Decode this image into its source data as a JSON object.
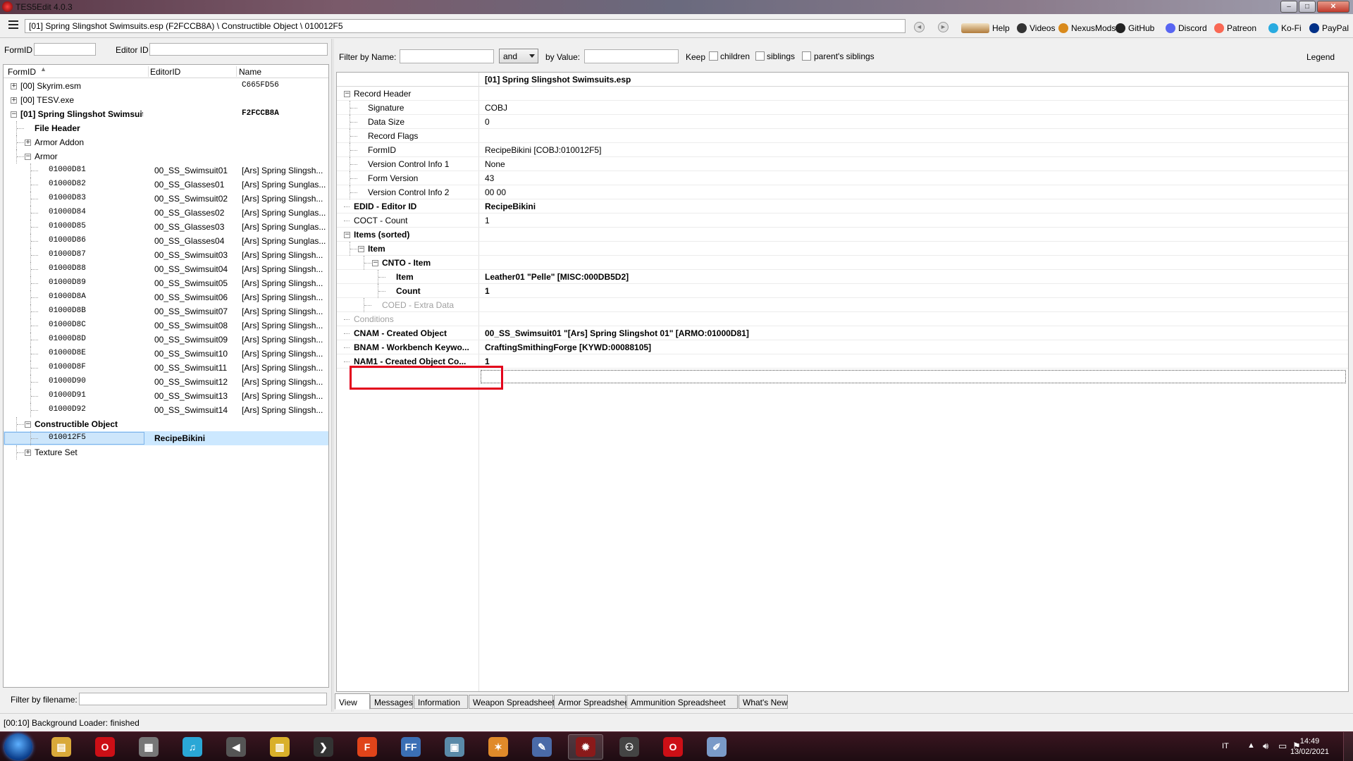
{
  "window": {
    "title": "TES5Edit 4.0.3",
    "min": "–",
    "max": "□",
    "close": "✕"
  },
  "toolbar": {
    "path": "[01] Spring Slingshot Swimsuits.esp (F2FCCB8A) \\ Constructible Object \\ 010012F5",
    "links": [
      {
        "label": "Help",
        "color": "#b07a3a"
      },
      {
        "label": "Videos",
        "color": "#333333"
      },
      {
        "label": "NexusMods",
        "color": "#d98a1c"
      },
      {
        "label": "GitHub",
        "color": "#222222"
      },
      {
        "label": "Discord",
        "color": "#5865f2"
      },
      {
        "label": "Patreon",
        "color": "#f96854"
      },
      {
        "label": "Ko-Fi",
        "color": "#29abe0"
      },
      {
        "label": "PayPal",
        "color": "#003087"
      }
    ]
  },
  "left": {
    "formid_label": "FormID",
    "editorid_label": "Editor ID",
    "columns": [
      "FormID",
      "EditorID",
      "Name"
    ],
    "filter_label": "Filter by filename:",
    "rows": [
      {
        "formid": "[00] Skyrim.esm",
        "editor": "",
        "name": "C665FD56",
        "level": 0,
        "exp": "+",
        "bold": false,
        "mono": false,
        "namemono": true
      },
      {
        "formid": "[00] TESV.exe",
        "editor": "",
        "name": "",
        "level": 0,
        "exp": "+",
        "bold": false,
        "mono": false
      },
      {
        "formid": "[01] Spring Slingshot Swimsuits.esp",
        "editor": "",
        "name": "F2FCCB8A",
        "level": 0,
        "exp": "−",
        "bold": true,
        "mono": false,
        "namemono": true
      },
      {
        "formid": "File Header",
        "editor": "",
        "name": "",
        "level": 1,
        "exp": "",
        "bold": true,
        "mono": false
      },
      {
        "formid": "Armor Addon",
        "editor": "",
        "name": "",
        "level": 1,
        "exp": "+",
        "bold": false,
        "mono": false
      },
      {
        "formid": "Armor",
        "editor": "",
        "name": "",
        "level": 1,
        "exp": "−",
        "bold": false,
        "mono": false
      },
      {
        "formid": "01000D81",
        "editor": "00_SS_Swimsuit01",
        "name": "[Ars] Spring Slingsh...",
        "level": 2,
        "exp": "",
        "bold": false,
        "mono": true
      },
      {
        "formid": "01000D82",
        "editor": "00_SS_Glasses01",
        "name": "[Ars] Spring Sunglas...",
        "level": 2,
        "exp": "",
        "bold": false,
        "mono": true
      },
      {
        "formid": "01000D83",
        "editor": "00_SS_Swimsuit02",
        "name": "[Ars] Spring Slingsh...",
        "level": 2,
        "exp": "",
        "bold": false,
        "mono": true
      },
      {
        "formid": "01000D84",
        "editor": "00_SS_Glasses02",
        "name": "[Ars] Spring Sunglas...",
        "level": 2,
        "exp": "",
        "bold": false,
        "mono": true
      },
      {
        "formid": "01000D85",
        "editor": "00_SS_Glasses03",
        "name": "[Ars] Spring Sunglas...",
        "level": 2,
        "exp": "",
        "bold": false,
        "mono": true
      },
      {
        "formid": "01000D86",
        "editor": "00_SS_Glasses04",
        "name": "[Ars] Spring Sunglas...",
        "level": 2,
        "exp": "",
        "bold": false,
        "mono": true
      },
      {
        "formid": "01000D87",
        "editor": "00_SS_Swimsuit03",
        "name": "[Ars] Spring Slingsh...",
        "level": 2,
        "exp": "",
        "bold": false,
        "mono": true
      },
      {
        "formid": "01000D88",
        "editor": "00_SS_Swimsuit04",
        "name": "[Ars] Spring Slingsh...",
        "level": 2,
        "exp": "",
        "bold": false,
        "mono": true
      },
      {
        "formid": "01000D89",
        "editor": "00_SS_Swimsuit05",
        "name": "[Ars] Spring Slingsh...",
        "level": 2,
        "exp": "",
        "bold": false,
        "mono": true
      },
      {
        "formid": "01000D8A",
        "editor": "00_SS_Swimsuit06",
        "name": "[Ars] Spring Slingsh...",
        "level": 2,
        "exp": "",
        "bold": false,
        "mono": true
      },
      {
        "formid": "01000D8B",
        "editor": "00_SS_Swimsuit07",
        "name": "[Ars] Spring Slingsh...",
        "level": 2,
        "exp": "",
        "bold": false,
        "mono": true
      },
      {
        "formid": "01000D8C",
        "editor": "00_SS_Swimsuit08",
        "name": "[Ars] Spring Slingsh...",
        "level": 2,
        "exp": "",
        "bold": false,
        "mono": true
      },
      {
        "formid": "01000D8D",
        "editor": "00_SS_Swimsuit09",
        "name": "[Ars] Spring Slingsh...",
        "level": 2,
        "exp": "",
        "bold": false,
        "mono": true
      },
      {
        "formid": "01000D8E",
        "editor": "00_SS_Swimsuit10",
        "name": "[Ars] Spring Slingsh...",
        "level": 2,
        "exp": "",
        "bold": false,
        "mono": true
      },
      {
        "formid": "01000D8F",
        "editor": "00_SS_Swimsuit11",
        "name": "[Ars] Spring Slingsh...",
        "level": 2,
        "exp": "",
        "bold": false,
        "mono": true
      },
      {
        "formid": "01000D90",
        "editor": "00_SS_Swimsuit12",
        "name": "[Ars] Spring Slingsh...",
        "level": 2,
        "exp": "",
        "bold": false,
        "mono": true
      },
      {
        "formid": "01000D91",
        "editor": "00_SS_Swimsuit13",
        "name": "[Ars] Spring Slingsh...",
        "level": 2,
        "exp": "",
        "bold": false,
        "mono": true
      },
      {
        "formid": "01000D92",
        "editor": "00_SS_Swimsuit14",
        "name": "[Ars] Spring Slingsh...",
        "level": 2,
        "exp": "",
        "bold": false,
        "mono": true
      },
      {
        "formid": "Constructible Object",
        "editor": "",
        "name": "",
        "level": 1,
        "exp": "−",
        "bold": true,
        "mono": false
      },
      {
        "formid": "010012F5",
        "editor": "RecipeBikini",
        "name": "",
        "level": 2,
        "exp": "",
        "bold": false,
        "mono": true,
        "selected": true,
        "editorbold": true
      },
      {
        "formid": "Texture Set",
        "editor": "",
        "name": "",
        "level": 1,
        "exp": "+",
        "bold": false,
        "mono": false
      }
    ]
  },
  "right": {
    "filter_name_label": "Filter by Name:",
    "and_value": "and",
    "by_value_label": "by Value:",
    "keep_label": "Keep",
    "children_label": "children",
    "siblings_label": "siblings",
    "parents_siblings_label": "parent's siblings",
    "legend_label": "Legend",
    "header": "[01] Spring Slingshot Swimsuits.esp",
    "rows": [
      {
        "name": "Record Header",
        "value": "",
        "level": 0,
        "exp": "−",
        "bold": false,
        "gray": false
      },
      {
        "name": "Signature",
        "value": "COBJ",
        "level": 1,
        "exp": "",
        "bold": false,
        "gray": false
      },
      {
        "name": "Data Size",
        "value": "0",
        "level": 1,
        "exp": "",
        "bold": false,
        "gray": false
      },
      {
        "name": "Record Flags",
        "value": "",
        "level": 1,
        "exp": "",
        "bold": false,
        "gray": false
      },
      {
        "name": "FormID",
        "value": "RecipeBikini [COBJ:010012F5]",
        "level": 1,
        "exp": "",
        "bold": false,
        "gray": false
      },
      {
        "name": "Version Control Info 1",
        "value": "None",
        "level": 1,
        "exp": "",
        "bold": false,
        "gray": false
      },
      {
        "name": "Form Version",
        "value": "43",
        "level": 1,
        "exp": "",
        "bold": false,
        "gray": false
      },
      {
        "name": "Version Control Info 2",
        "value": "00 00",
        "level": 1,
        "exp": "",
        "bold": false,
        "gray": false
      },
      {
        "name": "EDID - Editor ID",
        "value": "RecipeBikini",
        "level": 0,
        "exp": "",
        "bold": true,
        "gray": false
      },
      {
        "name": "COCT - Count",
        "value": "1",
        "level": 0,
        "exp": "",
        "bold": false,
        "gray": false
      },
      {
        "name": "Items (sorted)",
        "value": "",
        "level": 0,
        "exp": "−",
        "bold": true,
        "gray": false
      },
      {
        "name": "Item",
        "value": "",
        "level": 1,
        "exp": "−",
        "bold": true,
        "gray": false
      },
      {
        "name": "CNTO - Item",
        "value": "",
        "level": 2,
        "exp": "−",
        "bold": true,
        "gray": false
      },
      {
        "name": "Item",
        "value": "Leather01 \"Pelle\" [MISC:000DB5D2]",
        "level": 3,
        "exp": "",
        "bold": true,
        "gray": false
      },
      {
        "name": "Count",
        "value": "1",
        "level": 3,
        "exp": "",
        "bold": true,
        "gray": false
      },
      {
        "name": "COED - Extra Data",
        "value": "",
        "level": 2,
        "exp": "",
        "bold": false,
        "gray": true
      },
      {
        "name": "Conditions",
        "value": "",
        "level": 0,
        "exp": "",
        "bold": false,
        "gray": true
      },
      {
        "name": "CNAM - Created Object",
        "value": "00_SS_Swimsuit01 \"[Ars] Spring Slingshot 01\" [ARMO:01000D81]",
        "level": 0,
        "exp": "",
        "bold": true,
        "gray": false
      },
      {
        "name": "BNAM - Workbench Keywo...",
        "value": "CraftingSmithingForge [KYWD:00088105]",
        "level": 0,
        "exp": "",
        "bold": true,
        "gray": false
      },
      {
        "name": "NAM1 - Created Object Co...",
        "value": "1",
        "level": 0,
        "exp": "",
        "bold": true,
        "gray": false
      }
    ],
    "tabs": [
      "View",
      "Messages",
      "Information",
      "Weapon Spreadsheet",
      "Armor Spreadsheet",
      "Ammunition Spreadsheet",
      "What's New"
    ]
  },
  "status": {
    "text": "[00:10] Background Loader: finished"
  },
  "taskbar": {
    "apps": [
      {
        "name": "explorer",
        "color": "#d9a93a",
        "glyph": "▤"
      },
      {
        "name": "opera",
        "color": "#cc0f16",
        "glyph": "O"
      },
      {
        "name": "media",
        "color": "#777777",
        "glyph": "▦"
      },
      {
        "name": "itunes",
        "color": "#2aa7d6",
        "glyph": "♫"
      },
      {
        "name": "audio",
        "color": "#555555",
        "glyph": "◀"
      },
      {
        "name": "notes",
        "color": "#d9b02a",
        "glyph": "▥"
      },
      {
        "name": "black",
        "color": "#333333",
        "glyph": "❯"
      },
      {
        "name": "foxit",
        "color": "#e0441a",
        "glyph": "F"
      },
      {
        "name": "ffdec",
        "color": "#3b6fb5",
        "glyph": "FF"
      },
      {
        "name": "window",
        "color": "#5a8aa8",
        "glyph": "▣"
      },
      {
        "name": "blender",
        "color": "#e08a2a",
        "glyph": "✶"
      },
      {
        "name": "quill",
        "color": "#4a6aa8",
        "glyph": "✎"
      },
      {
        "name": "tes5edit",
        "color": "#8a1a1a",
        "glyph": "✹"
      },
      {
        "name": "people",
        "color": "#444444",
        "glyph": "⚇"
      },
      {
        "name": "opera2",
        "color": "#cc0f16",
        "glyph": "O"
      },
      {
        "name": "paint",
        "color": "#7a9ac8",
        "glyph": "✐"
      }
    ],
    "lang": "IT",
    "time": "14:49",
    "date": "13/02/2021"
  }
}
